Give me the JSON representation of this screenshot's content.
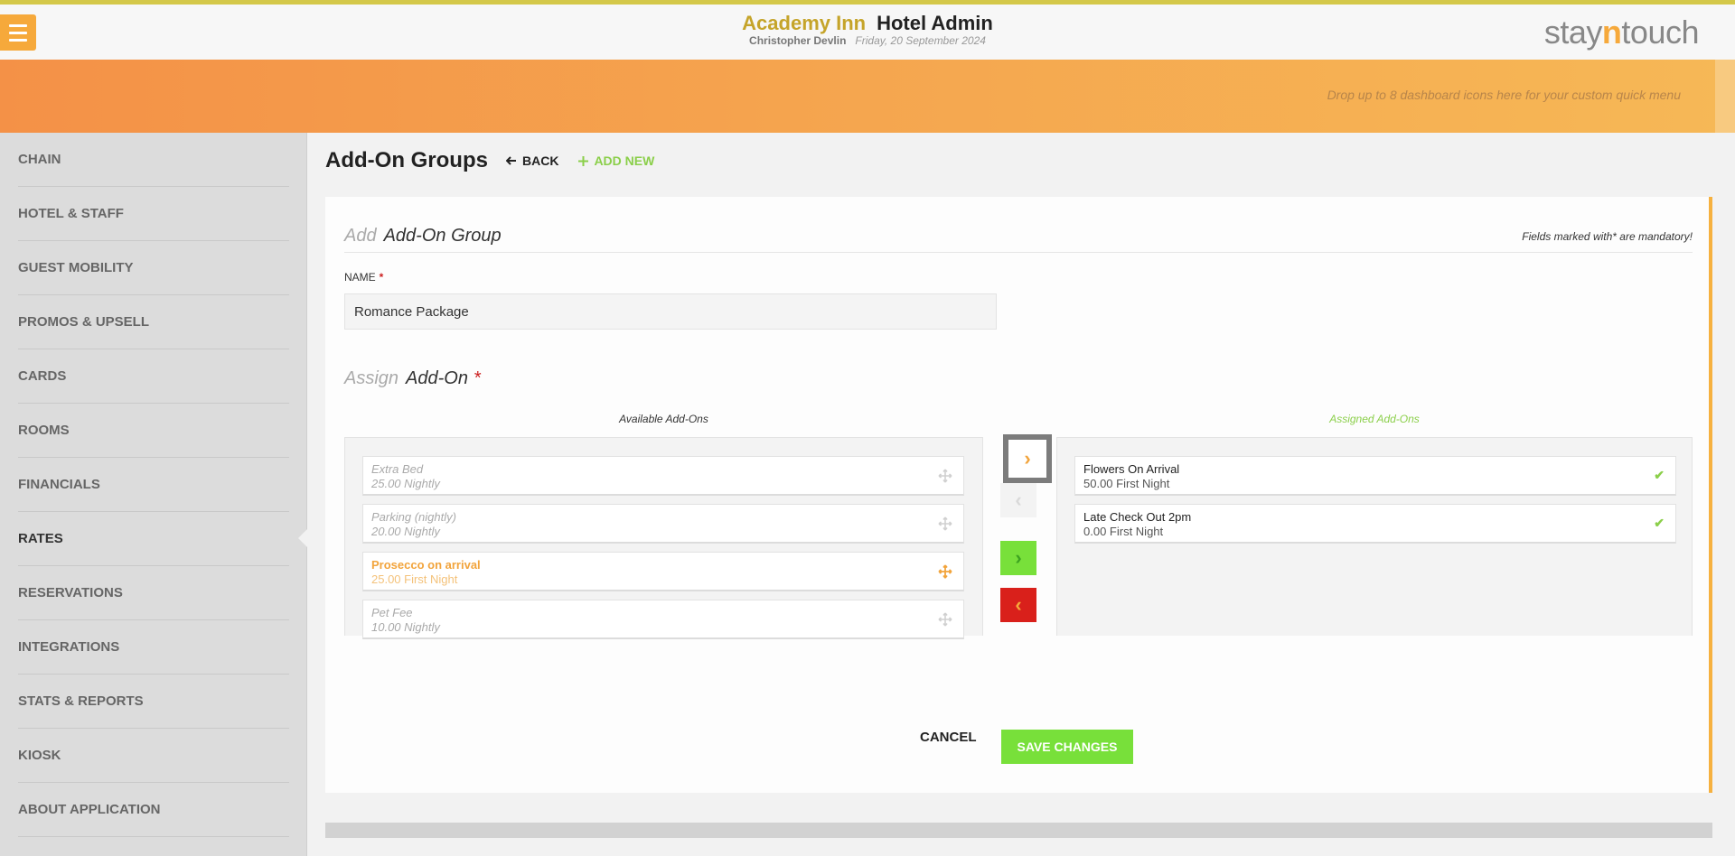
{
  "header": {
    "hotel_name": "Academy Inn",
    "app_name": "Hotel Admin",
    "user": "Christopher Devlin",
    "date": "Friday, 20 September 2024",
    "logo_pre": "stay",
    "logo_n": "n",
    "logo_post": "touch",
    "menu_icon": "hamburger-icon"
  },
  "dashboard": {
    "hint": "Drop up to 8 dashboard icons here for your custom quick menu"
  },
  "sidebar": {
    "items": [
      {
        "label": "CHAIN"
      },
      {
        "label": "HOTEL & STAFF"
      },
      {
        "label": "GUEST MOBILITY"
      },
      {
        "label": "PROMOS & UPSELL"
      },
      {
        "label": "CARDS"
      },
      {
        "label": "ROOMS"
      },
      {
        "label": "FINANCIALS"
      },
      {
        "label": "RATES"
      },
      {
        "label": "RESERVATIONS"
      },
      {
        "label": "INTEGRATIONS"
      },
      {
        "label": "STATS & REPORTS"
      },
      {
        "label": "KIOSK"
      },
      {
        "label": "ABOUT APPLICATION"
      }
    ],
    "active": "RATES"
  },
  "page": {
    "title": "Add-On Groups",
    "back_label": "BACK",
    "add_new_label": "ADD NEW"
  },
  "form": {
    "title_light": "Add",
    "title_dark": "Add-On Group",
    "mandatory_note": "Fields marked with* are mandatory!",
    "name_label": "NAME",
    "required_mark": "*",
    "name_value": "Romance Package",
    "assign_light": "Assign",
    "assign_dark": "Add-On",
    "available_header": "Available Add-Ons",
    "assigned_header": "Assigned Add-Ons",
    "available": [
      {
        "name": "Extra Bed",
        "price": "25.00 Nightly"
      },
      {
        "name": "Parking (nightly)",
        "price": "20.00 Nightly"
      },
      {
        "name": "Prosecco on arrival",
        "price": "25.00 First Night"
      },
      {
        "name": "Pet Fee",
        "price": "10.00 Nightly"
      }
    ],
    "assigned": [
      {
        "name": "Flowers On Arrival",
        "price": "50.00 First Night"
      },
      {
        "name": "Late Check Out 2pm",
        "price": "0.00 First Night"
      }
    ],
    "cancel_label": "CANCEL",
    "save_label": "SAVE CHANGES"
  },
  "colors": {
    "accent_orange": "#f6a93b",
    "accent_green": "#78e03a",
    "danger_red": "#d9201b",
    "brand_gold": "#c5a42a"
  }
}
